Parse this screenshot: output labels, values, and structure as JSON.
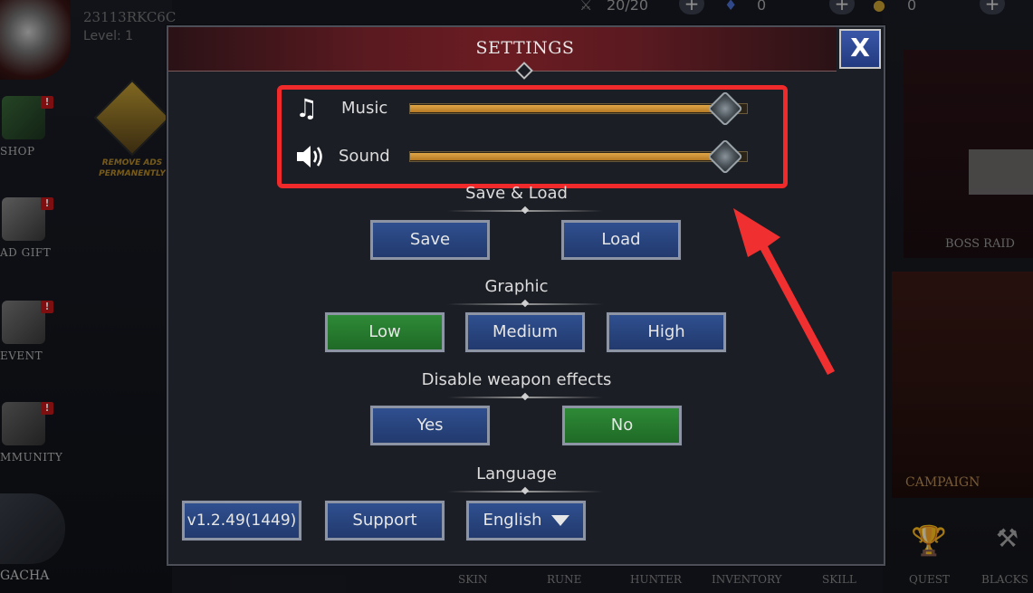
{
  "background": {
    "player": {
      "id": "23113RKC6C",
      "level": "Level: 1"
    },
    "topbar": {
      "stamina": "20/20",
      "gems": "0",
      "gold": "0"
    },
    "sidebar": [
      {
        "label": "SHOP"
      },
      {
        "label": "AD GIFT"
      },
      {
        "label": "EVENT"
      },
      {
        "label": "MMUNITY"
      }
    ],
    "remove_ads": "REMOVE ADS PERMANENTLY",
    "boss_raid": "BOSS RAID",
    "campaign": "CAMPAIGN",
    "gacha": "GACHA",
    "bottom_nav": [
      "SKIN",
      "RUNE",
      "HUNTER",
      "INVENTORY",
      "SKILL",
      "QUEST",
      "BLACKS"
    ]
  },
  "settings": {
    "title": "SETTINGS",
    "close_label": "X",
    "music": {
      "label": "Music",
      "level": 1.0
    },
    "sound": {
      "label": "Sound",
      "level": 1.0
    },
    "save_load": {
      "title": "Save & Load",
      "save_label": "Save",
      "load_label": "Load"
    },
    "graphic": {
      "title": "Graphic",
      "options": [
        "Low",
        "Medium",
        "High"
      ],
      "selected": "Low"
    },
    "weapon_effects": {
      "title": "Disable weapon effects",
      "yes_label": "Yes",
      "no_label": "No",
      "selected": "No"
    },
    "language": {
      "title": "Language",
      "version_label": "v1.2.49(1449)",
      "support_label": "Support",
      "selected": "English"
    }
  },
  "colors": {
    "highlight": "#f02a2a",
    "selected_option": "#2e8a36",
    "button": "#2f4f8f",
    "slider": "#e1a646"
  }
}
